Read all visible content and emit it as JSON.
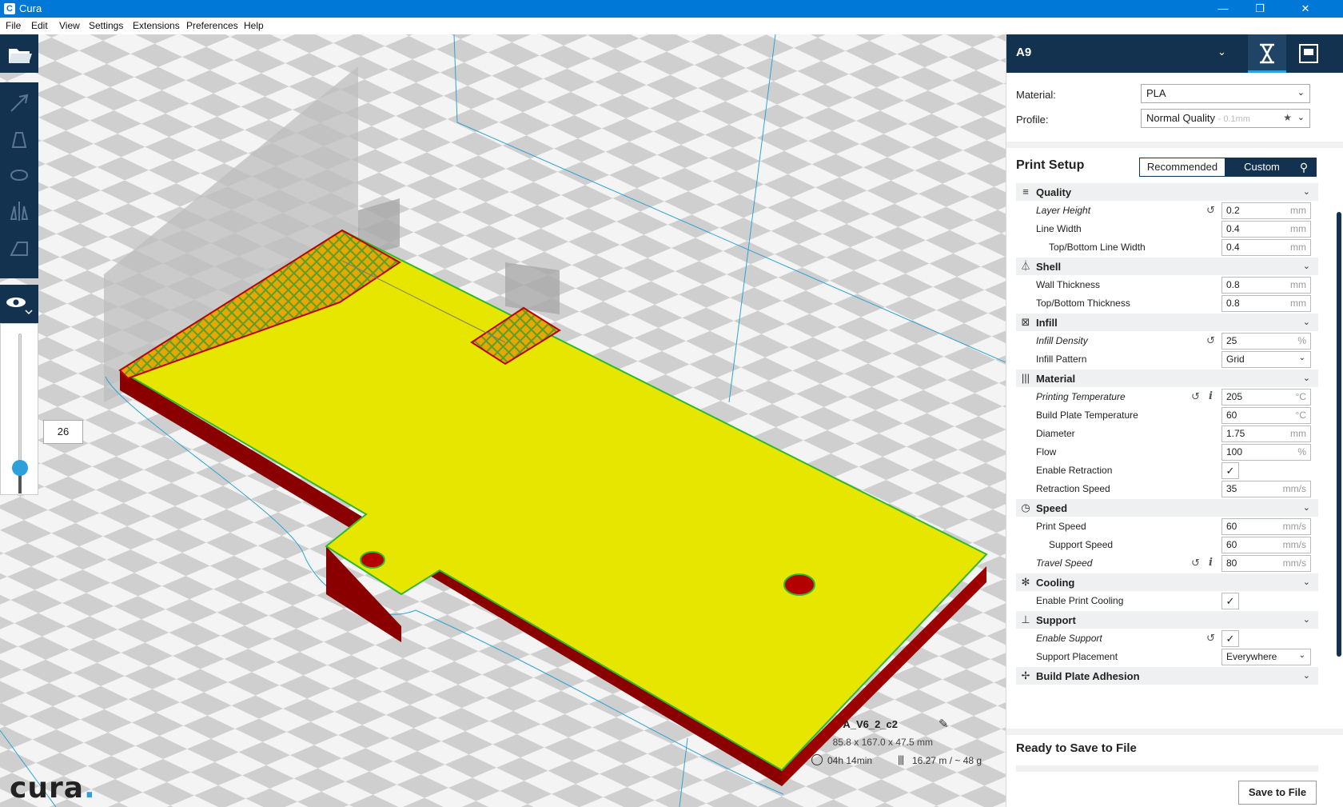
{
  "window": {
    "title": "Cura",
    "app_icon": "C",
    "minimize": "—",
    "restore": "❐",
    "close": "✕"
  },
  "menu": [
    "File",
    "Edit",
    "View",
    "Settings",
    "Extensions",
    "Preferences",
    "Help"
  ],
  "layer_view": {
    "current_layer": "26"
  },
  "logo": {
    "text": "cura",
    "dot": "."
  },
  "job": {
    "name": "A_V6_2_c2",
    "dimensions": "85.8 x 167.0 x 47.5 mm",
    "time": "04h 14min",
    "material": "16.27 m / ~ 48 g"
  },
  "sidebar": {
    "printer": "A9",
    "material_label": "Material:",
    "material_value": "PLA",
    "profile_label": "Profile:",
    "profile_value": "Normal Quality",
    "profile_detail": "- 0.1mm",
    "print_setup_title": "Print Setup",
    "mode_recommended": "Recommended",
    "mode_custom": "Custom",
    "ready_title": "Ready to Save to File",
    "save_button": "Save to File"
  },
  "categories": {
    "quality": "Quality",
    "shell": "Shell",
    "infill": "Infill",
    "material": "Material",
    "speed": "Speed",
    "cooling": "Cooling",
    "support": "Support",
    "adhesion": "Build Plate Adhesion"
  },
  "settings": {
    "layer_height": {
      "label": "Layer Height",
      "value": "0.2",
      "unit": "mm"
    },
    "line_width": {
      "label": "Line Width",
      "value": "0.4",
      "unit": "mm"
    },
    "top_bottom_line_width": {
      "label": "Top/Bottom Line Width",
      "value": "0.4",
      "unit": "mm"
    },
    "wall_thickness": {
      "label": "Wall Thickness",
      "value": "0.8",
      "unit": "mm"
    },
    "top_bottom_thickness": {
      "label": "Top/Bottom Thickness",
      "value": "0.8",
      "unit": "mm"
    },
    "infill_density": {
      "label": "Infill Density",
      "value": "25",
      "unit": "%"
    },
    "infill_pattern": {
      "label": "Infill Pattern",
      "value": "Grid"
    },
    "printing_temperature": {
      "label": "Printing Temperature",
      "value": "205",
      "unit": "°C"
    },
    "build_plate_temperature": {
      "label": "Build Plate Temperature",
      "value": "60",
      "unit": "°C"
    },
    "diameter": {
      "label": "Diameter",
      "value": "1.75",
      "unit": "mm"
    },
    "flow": {
      "label": "Flow",
      "value": "100",
      "unit": "%"
    },
    "enable_retraction": {
      "label": "Enable Retraction",
      "checked": "✓"
    },
    "retraction_speed": {
      "label": "Retraction Speed",
      "value": "35",
      "unit": "mm/s"
    },
    "print_speed": {
      "label": "Print Speed",
      "value": "60",
      "unit": "mm/s"
    },
    "support_speed": {
      "label": "Support Speed",
      "value": "60",
      "unit": "mm/s"
    },
    "travel_speed": {
      "label": "Travel Speed",
      "value": "80",
      "unit": "mm/s"
    },
    "enable_print_cooling": {
      "label": "Enable Print Cooling",
      "checked": "✓"
    },
    "enable_support": {
      "label": "Enable Support",
      "checked": "✓"
    },
    "support_placement": {
      "label": "Support Placement",
      "value": "Everywhere"
    }
  },
  "icons": {
    "open": "folder-icon",
    "view": "eye-icon",
    "prepare": "prepare-icon",
    "monitor": "monitor-icon",
    "reset": "↺",
    "info": "i",
    "chevron": "⌄",
    "search": "⚲",
    "edit": "✎"
  },
  "colors": {
    "accent": "#2d9fd9",
    "header": "#12324f",
    "model_top": "#e6e600",
    "model_wall": "#b30000",
    "titlebar": "#0078d7"
  }
}
